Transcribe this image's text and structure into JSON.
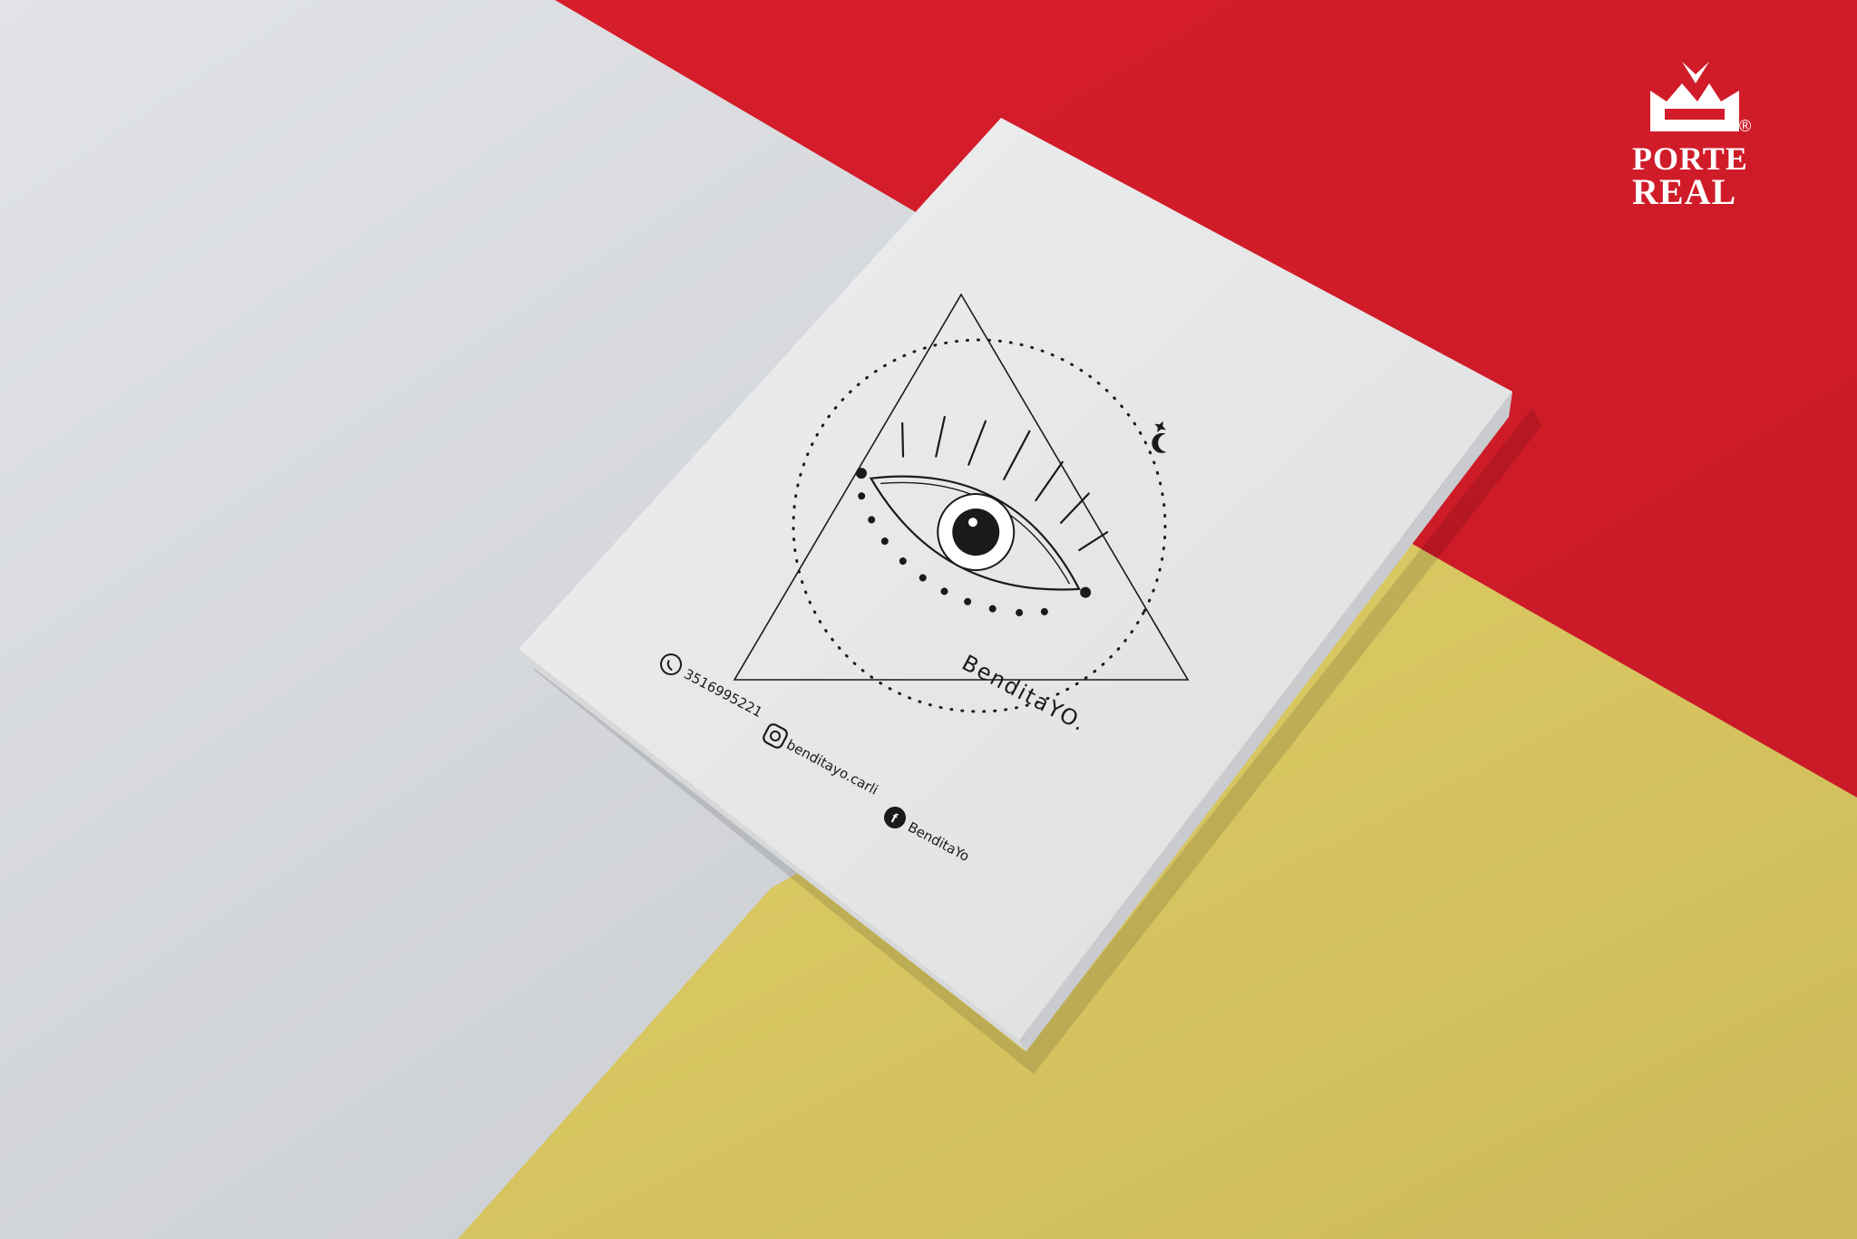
{
  "brand": {
    "line1": "PORTE",
    "line2": "REAL",
    "mark": "®"
  },
  "box": {
    "logo_text": "BenditaYO.",
    "contacts": [
      {
        "icon": "whatsapp-icon",
        "text": "3516995221"
      },
      {
        "icon": "instagram-icon",
        "text": "benditayo.carli"
      },
      {
        "icon": "facebook-icon",
        "text": "BenditaYo"
      }
    ]
  },
  "colors": {
    "red": "#d41c2a",
    "yellow": "#d8c55d",
    "gray": "#cfd2d6",
    "box": "#e4e6e8"
  }
}
